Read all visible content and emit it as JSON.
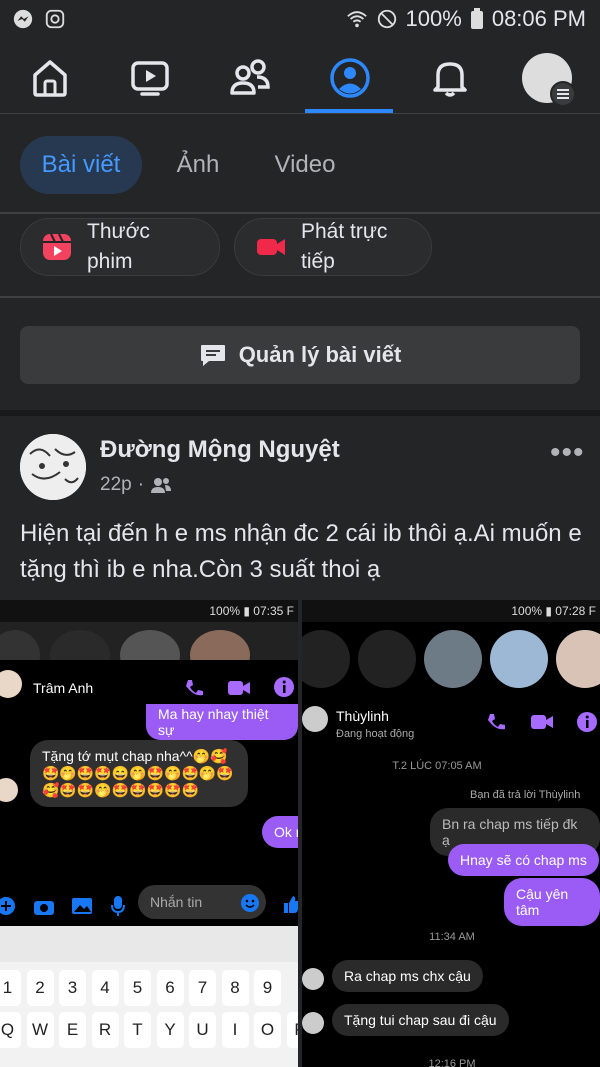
{
  "status_bar": {
    "battery": "100%",
    "time": "08:06 PM"
  },
  "nav": {
    "items": [
      "home-icon",
      "video-icon",
      "friends-icon",
      "profile-icon",
      "notifications-icon",
      "menu-avatar"
    ]
  },
  "tabs": [
    {
      "label": "Bài viết",
      "active": true
    },
    {
      "label": "Ảnh",
      "active": false
    },
    {
      "label": "Video",
      "active": false
    }
  ],
  "pills": [
    {
      "line1": "Thước",
      "line2": "phim",
      "icon": "reels-icon"
    },
    {
      "line1": "Phát trực",
      "line2": "tiếp",
      "icon": "live-video-icon"
    }
  ],
  "manage_posts": "Quản lý bài viết",
  "post": {
    "author": "Đường Mộng Nguyệt",
    "time": "22p",
    "separator": "·",
    "text": "Hiện tại đến h e ms nhận đc 2 cái ib thôi ạ.Ai muốn e tặng thì ib e nha.Còn 3 suất thoi ạ"
  },
  "shot1": {
    "status": "100% ▮ 07:35 F",
    "contact": "Trâm Anh",
    "top_bubble": "Ma hay nhay thiệt sự",
    "message": "Tặng tớ mụt chap nha^^🤭🥰🤩🤭🤩🤩😄🤭🤩🤭🤩🤭🤩🥰🤩🤩🤭🤩🤩🤩🤩🤩",
    "reply": "Ok r",
    "input_placeholder": "Nhắn tin",
    "keys_row1": [
      "1",
      "2",
      "3",
      "4",
      "5",
      "6",
      "7",
      "8",
      "9"
    ],
    "keys_row2": [
      "Q",
      "W",
      "E",
      "R",
      "T",
      "Y",
      "U",
      "I",
      "O",
      "P"
    ]
  },
  "shot2": {
    "status": "100% ▮ 07:28 F",
    "contact": "Thùylinh",
    "presence": "Đang hoạt động",
    "date1": "T.2 LÚC 07:05 AM",
    "reply_note": "Bạn đã trả lời Thùylinh",
    "quoted": "Bn ra chap ms tiếp đk ạ",
    "m1": "Hnay sẽ  có chap ms",
    "m2": "Cậu yên tâm",
    "date2": "11:34 AM",
    "m3": "Ra chap ms chx cậu",
    "m4": "Tặng tui chap sau đi cậu",
    "date3": "12:16 PM"
  },
  "colors": {
    "accent": "#2d88ff",
    "messenger_purple": "#8a5cf5"
  }
}
